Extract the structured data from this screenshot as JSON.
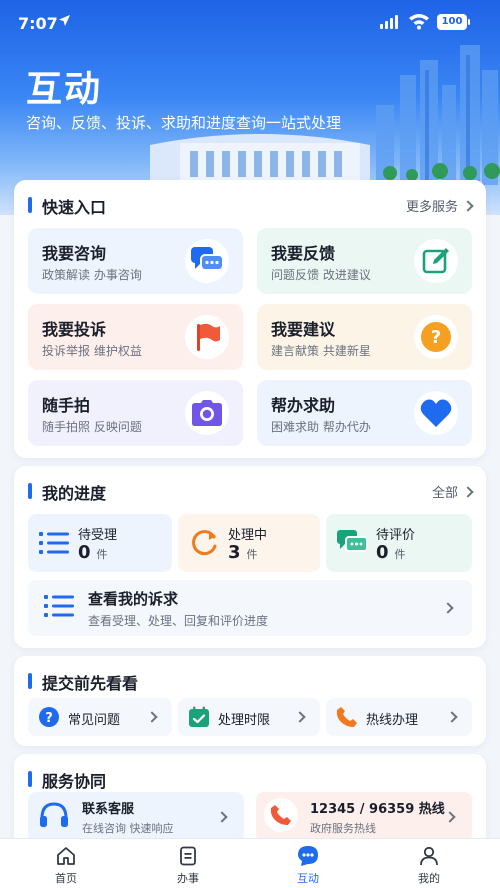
{
  "status_bar": {
    "time": "7:07",
    "battery": "100"
  },
  "hero": {
    "title": "互动",
    "subtitle": "咨询、反馈、投诉、求助和进度查询一站式处理"
  },
  "quick_entry": {
    "title": "快速入口",
    "more": "更多服务",
    "tiles": [
      {
        "title": "我要咨询",
        "sub": "政策解读 办事咨询",
        "icon": "chat-bubbles-icon",
        "bg": "#eef4fd",
        "color": "#1f6bf0"
      },
      {
        "title": "我要反馈",
        "sub": "问题反馈 改进建议",
        "icon": "edit-icon",
        "bg": "#eaf7f2",
        "color": "#1aa37a"
      },
      {
        "title": "我要投诉",
        "sub": "投诉举报 维护权益",
        "icon": "flag-icon",
        "bg": "#fdf0ec",
        "color": "#f05a3a"
      },
      {
        "title": "我要建议",
        "sub": "建言献策 共建新星",
        "icon": "question-icon",
        "bg": "#fdf4e8",
        "color": "#f5a020"
      },
      {
        "title": "随手拍",
        "sub": "随手拍照 反映问题",
        "icon": "camera-icon",
        "bg": "#f1f0fd",
        "color": "#7055e6"
      },
      {
        "title": "帮办求助",
        "sub": "困难求助 帮办代办",
        "icon": "heart-icon",
        "bg": "#eef4fd",
        "color": "#1f6bf0"
      }
    ]
  },
  "progress": {
    "title": "我的进度",
    "more": "全部",
    "items": [
      {
        "label": "待受理",
        "count": "0",
        "unit": "件",
        "icon": "list-icon",
        "bg": "#eef4fd",
        "color": "#1f6bf0"
      },
      {
        "label": "处理中",
        "count": "3",
        "unit": "件",
        "icon": "refresh-icon",
        "bg": "#fdf4ec",
        "color": "#f07a20"
      },
      {
        "label": "待评价",
        "count": "0",
        "unit": "件",
        "icon": "chat-bubbles-icon",
        "bg": "#eaf7f2",
        "color": "#1aa37a"
      }
    ],
    "appeals": {
      "title": "查看我的诉求",
      "sub": "查看受理、处理、回复和评价进度"
    }
  },
  "before_submit": {
    "title": "提交前先看看",
    "items": [
      {
        "label": "常见问题",
        "icon": "question-icon",
        "color": "#1f6bf0"
      },
      {
        "label": "处理时限",
        "icon": "calendar-check-icon",
        "color": "#1aa37a"
      },
      {
        "label": "热线办理",
        "icon": "phone-icon",
        "color": "#f07a20"
      }
    ]
  },
  "service": {
    "title": "服务协同",
    "items": [
      {
        "title": "联系客服",
        "sub": "在线咨询 快速响应",
        "icon": "headset-icon",
        "bg": "#eef4fd",
        "color": "#1f6bf0"
      },
      {
        "title": "12345 / 96359 热线",
        "sub": "政府服务热线",
        "icon": "phone-icon",
        "bg": "#fdf0ec",
        "color": "#f05a3a"
      }
    ]
  },
  "nav": {
    "items": [
      {
        "label": "首页",
        "icon": "home-icon"
      },
      {
        "label": "办事",
        "icon": "document-icon"
      },
      {
        "label": "互动",
        "icon": "interact-icon",
        "active": true
      },
      {
        "label": "我的",
        "icon": "user-icon"
      }
    ]
  }
}
